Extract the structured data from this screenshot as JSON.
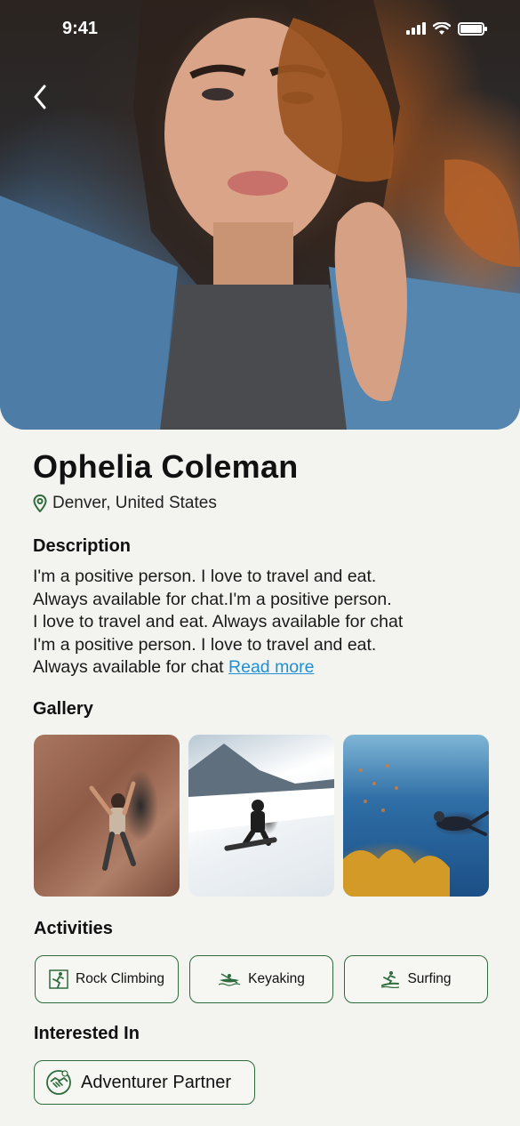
{
  "status_bar": {
    "time": "9:41"
  },
  "profile": {
    "name": "Ophelia Coleman",
    "location": "Denver, United States"
  },
  "description": {
    "title": "Description",
    "lines": [
      "I'm a positive person. I love to travel and eat.",
      "Always available for chat.I'm a positive person.",
      "I love to travel and eat. Always available for chat",
      "I'm a positive person. I love to travel and eat.",
      "Always available for chat"
    ],
    "read_more": "Read more"
  },
  "gallery": {
    "title": "Gallery",
    "images": [
      "rock-climbing-photo",
      "snowboarding-photo",
      "scuba-diving-photo"
    ]
  },
  "activities": {
    "title": "Activities",
    "items": [
      {
        "label": "Rock Climbing",
        "icon": "climbing-icon"
      },
      {
        "label": "Keyaking",
        "icon": "kayak-icon"
      },
      {
        "label": "Surfing",
        "icon": "surfing-icon"
      }
    ]
  },
  "interests": {
    "title": "Interested In",
    "items": [
      {
        "label": "Adventurer Partner",
        "icon": "handshake-icon"
      }
    ]
  },
  "colors": {
    "accent_green": "#2e6b3d",
    "link_blue": "#1e90d6",
    "background": "#f3f4ef"
  }
}
